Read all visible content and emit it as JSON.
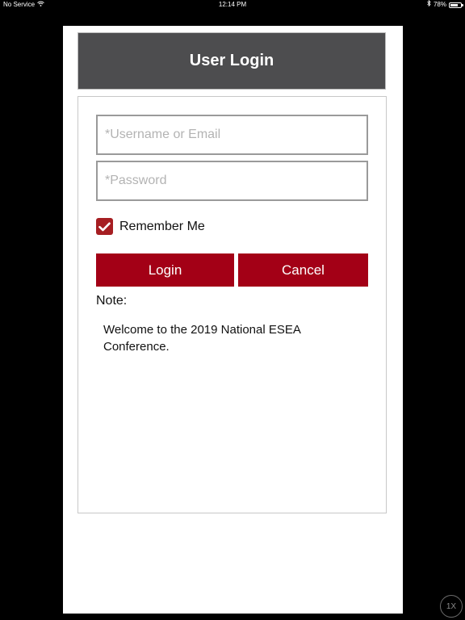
{
  "status_bar": {
    "carrier": "No Service",
    "time": "12:14 PM",
    "battery_percent": "78%",
    "battery_level": 0.78
  },
  "header": {
    "title": "User Login"
  },
  "form": {
    "username_placeholder": "*Username or Email",
    "username_value": "",
    "password_placeholder": "*Password",
    "password_value": "",
    "remember_label": "Remember Me",
    "remember_checked": true,
    "login_label": "Login",
    "cancel_label": "Cancel"
  },
  "note": {
    "label": "Note:",
    "text": "Welcome to the 2019 National ESEA Conference."
  },
  "zoom_badge": "1X",
  "colors": {
    "header_bg": "#4d4d4f",
    "button_bg": "#a30016",
    "checkbox_bg": "#a61e22"
  },
  "icons": {
    "wifi": "wifi-icon",
    "bluetooth": "bluetooth-icon",
    "battery": "battery-icon",
    "checkmark": "checkmark-icon"
  }
}
